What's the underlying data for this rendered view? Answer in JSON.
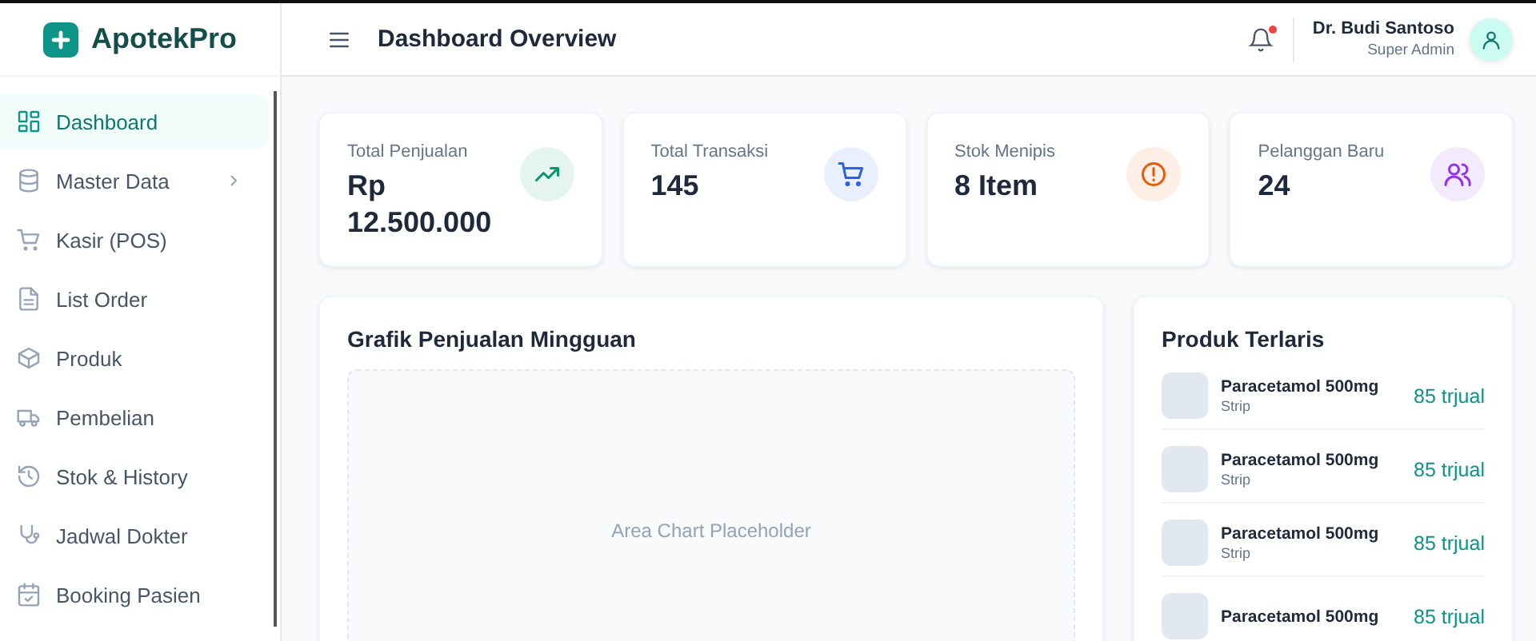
{
  "brand": {
    "name": "ApotekPro"
  },
  "header": {
    "title": "Dashboard Overview",
    "notifications": {
      "unread": true
    },
    "user": {
      "name": "Dr. Budi Santoso",
      "role": "Super Admin"
    }
  },
  "sidebar": {
    "items": [
      {
        "label": "Dashboard",
        "selected": true,
        "submenu": false
      },
      {
        "label": "Master Data",
        "selected": false,
        "submenu": true
      },
      {
        "label": "Kasir (POS)",
        "selected": false,
        "submenu": false
      },
      {
        "label": "List Order",
        "selected": false,
        "submenu": false
      },
      {
        "label": "Produk",
        "selected": false,
        "submenu": false
      },
      {
        "label": "Pembelian",
        "selected": false,
        "submenu": false
      },
      {
        "label": "Stok & History",
        "selected": false,
        "submenu": false
      },
      {
        "label": "Jadwal Dokter",
        "selected": false,
        "submenu": false
      },
      {
        "label": "Booking Pasien",
        "selected": false,
        "submenu": false
      }
    ]
  },
  "stats": [
    {
      "label": "Total Penjualan",
      "value": "Rp 12.500.000",
      "color": "#059669"
    },
    {
      "label": "Total Transaksi",
      "value": "145",
      "color": "#2563eb"
    },
    {
      "label": "Stok Menipis",
      "value": "8 Item",
      "color": "#ea580c"
    },
    {
      "label": "Pelanggan Baru",
      "value": "24",
      "color": "#9333ea"
    }
  ],
  "chart_panel": {
    "title": "Grafik Penjualan Mingguan",
    "placeholder": "Area Chart Placeholder"
  },
  "top_products": {
    "title": "Produk Terlaris",
    "items": [
      {
        "name": "Paracetamol 500mg",
        "unit": "Strip",
        "sold": "85 trjual"
      },
      {
        "name": "Paracetamol 500mg",
        "unit": "Strip",
        "sold": "85 trjual"
      },
      {
        "name": "Paracetamol 500mg",
        "unit": "Strip",
        "sold": "85 trjual"
      },
      {
        "name": "Paracetamol 500mg",
        "sold": "85 trjual"
      }
    ]
  }
}
